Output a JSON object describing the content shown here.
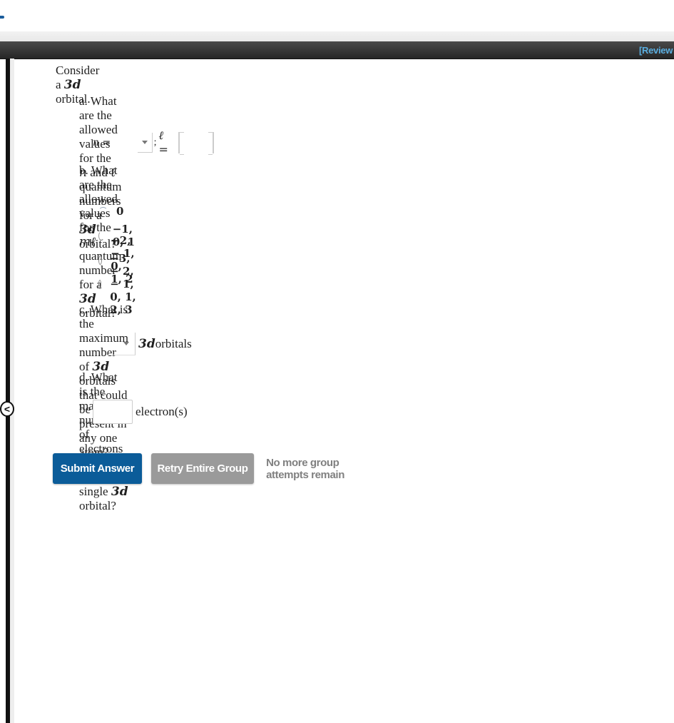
{
  "header": {
    "review_link": "[Review"
  },
  "sidebar": {
    "collapse_glyph": "<"
  },
  "intro": {
    "prefix": "Consider a ",
    "orbital": "3d",
    "suffix": " orbital."
  },
  "question_a": {
    "prefix": "a. What are the allowed values for the ",
    "n": "n",
    "and": " and ",
    "l": "ℓ",
    "middle": " quantum numbers for a ",
    "orbital": "3d",
    "suffix": " orbital?",
    "n_label": "n =",
    "n_select_value": "",
    "separator": ";",
    "l_label": "ℓ =",
    "l_input_value": ""
  },
  "question_b": {
    "prefix": "b. What are the allowed values for the ",
    "ml": "mℓ",
    "middle": " quantum number for a ",
    "orbital": "3d",
    "suffix": " orbital?",
    "options": [
      {
        "label": "0",
        "selected": false
      },
      {
        "label": "−1, 0, 1",
        "selected": false
      },
      {
        "label": "−2, − 1, 0, 1, 2",
        "selected": false
      },
      {
        "label": "−3, − 2, − 1, 0, 1, 2, 3",
        "selected": false
      }
    ]
  },
  "question_c": {
    "prefix": "c. What is the maximum number of ",
    "orbital": "3d",
    "suffix": " orbitals that could be present in any one atom?",
    "select_value": "",
    "unit_orbital": "3d",
    "unit_suffix": " orbitals"
  },
  "question_d": {
    "prefix": "d. What is the maximum number of electrons that could occupy a single ",
    "orbital": "3d",
    "suffix": " orbital?",
    "input_value": "",
    "unit": "electron(s)"
  },
  "actions": {
    "submit_label": "Submit Answer",
    "retry_label": "Retry Entire Group",
    "status": "No more group attempts remain"
  },
  "colors": {
    "submit_bg": "#0b5c99",
    "retry_bg": "#9a9a9a",
    "review_link": "#5aaee0",
    "header_bar": "#303030",
    "status_text": "#808080"
  }
}
